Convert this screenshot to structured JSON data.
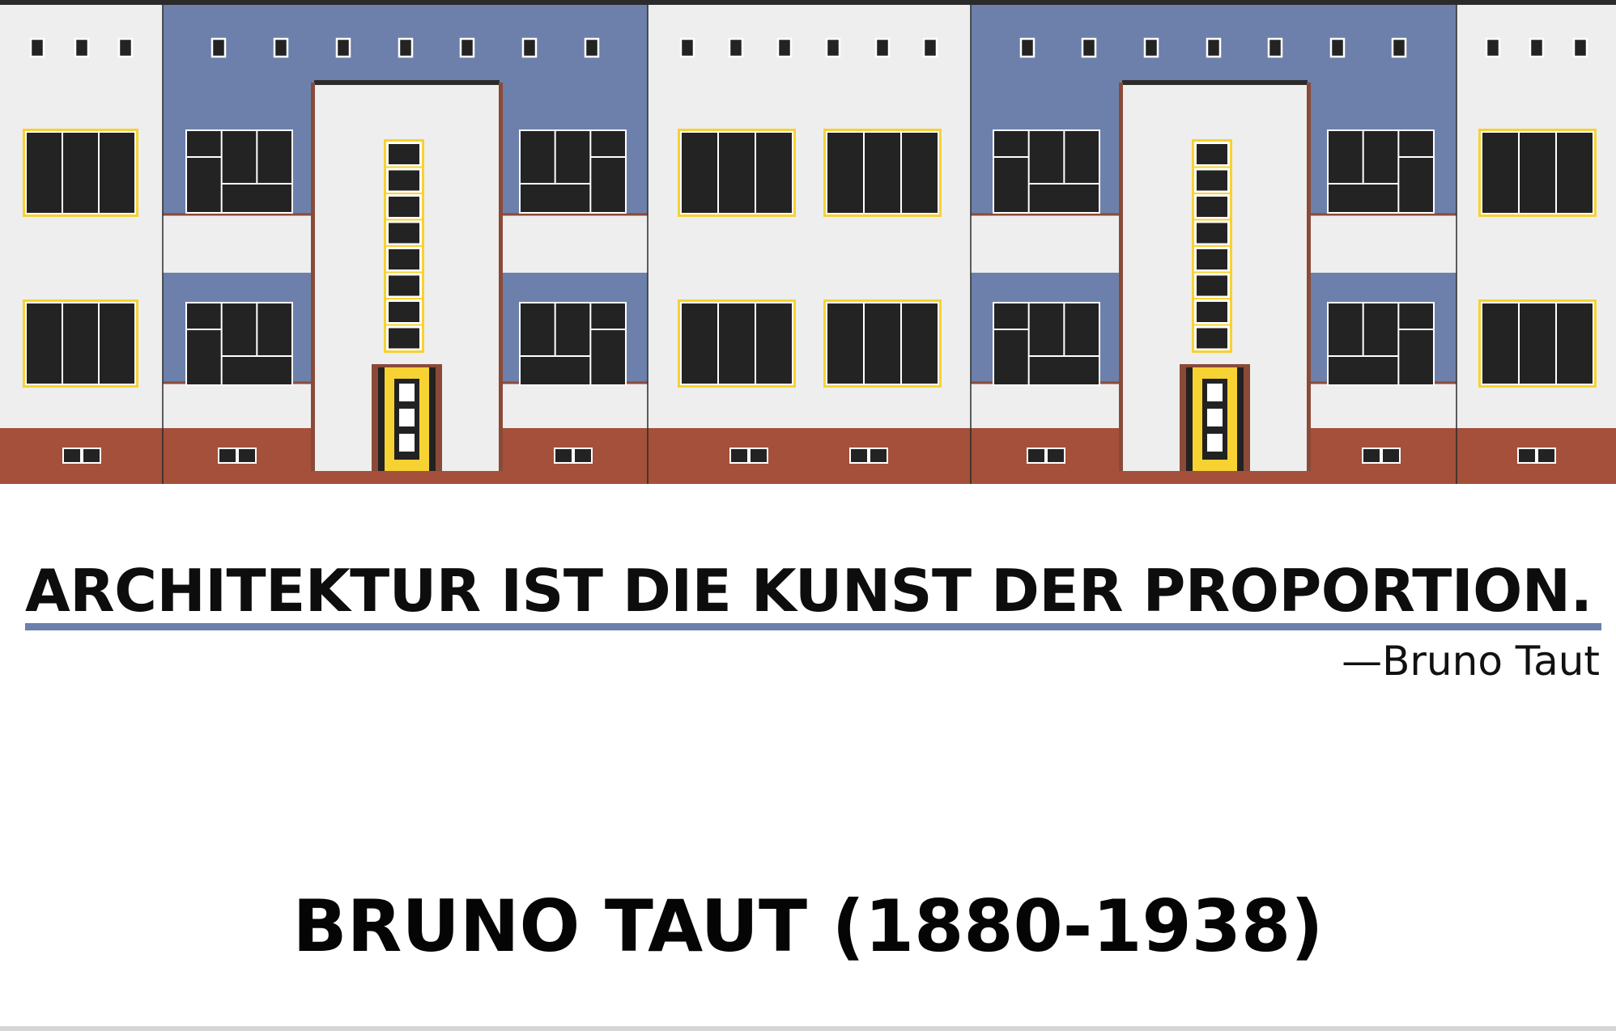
{
  "poster": {
    "quote": "ARCHITEKTUR IST DIE KUNST DER PROPORTION.",
    "attribution": "—Bruno Taut",
    "heading": "BRUNO TAUT (1880-1938)"
  },
  "illustration": {
    "subject": "Bruno Taut style apartment facade",
    "colors": {
      "wall_white": "#eeeeee",
      "wall_blue": "#6c80ab",
      "base_red": "#a4503a",
      "window_dark": "#232323",
      "window_frame": "#ffffff",
      "accent_yellow": "#f6d232",
      "outline": "#2a2a2a",
      "rule_blue": "#6c80ab"
    }
  }
}
